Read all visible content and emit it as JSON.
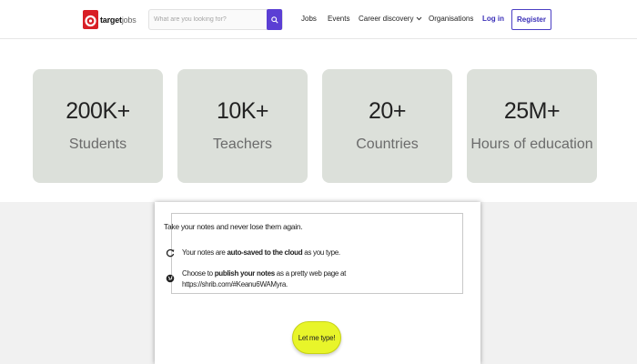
{
  "header": {
    "logo_text_bold": "target",
    "logo_text_rest": "jobs",
    "search_placeholder": "What are you looking for?",
    "nav": {
      "jobs": "Jobs",
      "events": "Events",
      "career": "Career discovery",
      "orgs": "Organisations"
    },
    "login": "Log in",
    "register": "Register",
    "brand_color": "#5b3fd4"
  },
  "stats": [
    {
      "value": "200K+",
      "label": "Students"
    },
    {
      "value": "10K+",
      "label": "Teachers"
    },
    {
      "value": "20+",
      "label": "Countries"
    },
    {
      "value": "25M+",
      "label": "Hours of education"
    }
  ],
  "notes": {
    "title": "Take your notes and never lose them again.",
    "feature1": {
      "pre": "Your notes are ",
      "bold": "auto-saved to the cloud",
      "post": " as you type."
    },
    "feature2": {
      "pre": "Choose to ",
      "bold": "publish your notes",
      "post": " as a pretty web page at",
      "url": "https://shrib.com/#Keanu6WAMyra."
    },
    "cta": "Let me type!"
  }
}
